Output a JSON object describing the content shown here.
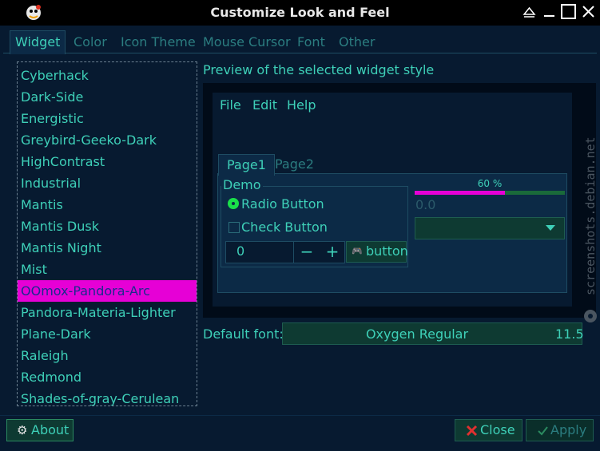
{
  "window": {
    "title": "Customize Look and Feel"
  },
  "tabs": [
    "Widget",
    "Color",
    "Icon Theme",
    "Mouse Cursor",
    "Font",
    "Other"
  ],
  "theme_list": {
    "items": [
      "Cyberhack",
      "Dark-Side",
      "Energistic",
      "Greybird-Geeko-Dark",
      "HighContrast",
      "Industrial",
      "Mantis",
      "Mantis Dusk",
      "Mantis Night",
      "Mist",
      "OOmox-Pandora-Arc",
      "Pandora-Materia-Lighter",
      "Plane-Dark",
      "Raleigh",
      "Redmond",
      "Shades-of-gray-Cerulean"
    ],
    "selected": "OOmox-Pandora-Arc"
  },
  "preview": {
    "label": "Preview of the selected widget style",
    "menu": [
      "File",
      "Edit",
      "Help"
    ],
    "tabs": [
      "Page1",
      "Page2"
    ],
    "frame_label": "Demo",
    "radio_label": "Radio Button",
    "check_label": "Check Button",
    "spin_value": "0",
    "spin_minus": "−",
    "spin_plus": "+",
    "button_label": "button",
    "progress_label": "60 %",
    "progress_fraction": 0.6,
    "scale_value": "0.0"
  },
  "font": {
    "label": "Default font:",
    "name": "Oxygen Regular",
    "size": "11.5"
  },
  "buttons": {
    "about": "About",
    "close": "Close",
    "apply": "Apply"
  },
  "watermark": "screenshots.debian.net",
  "colors": {
    "accent": "#3ed0b8",
    "selection": "#e600d6",
    "background": "#071a30"
  }
}
